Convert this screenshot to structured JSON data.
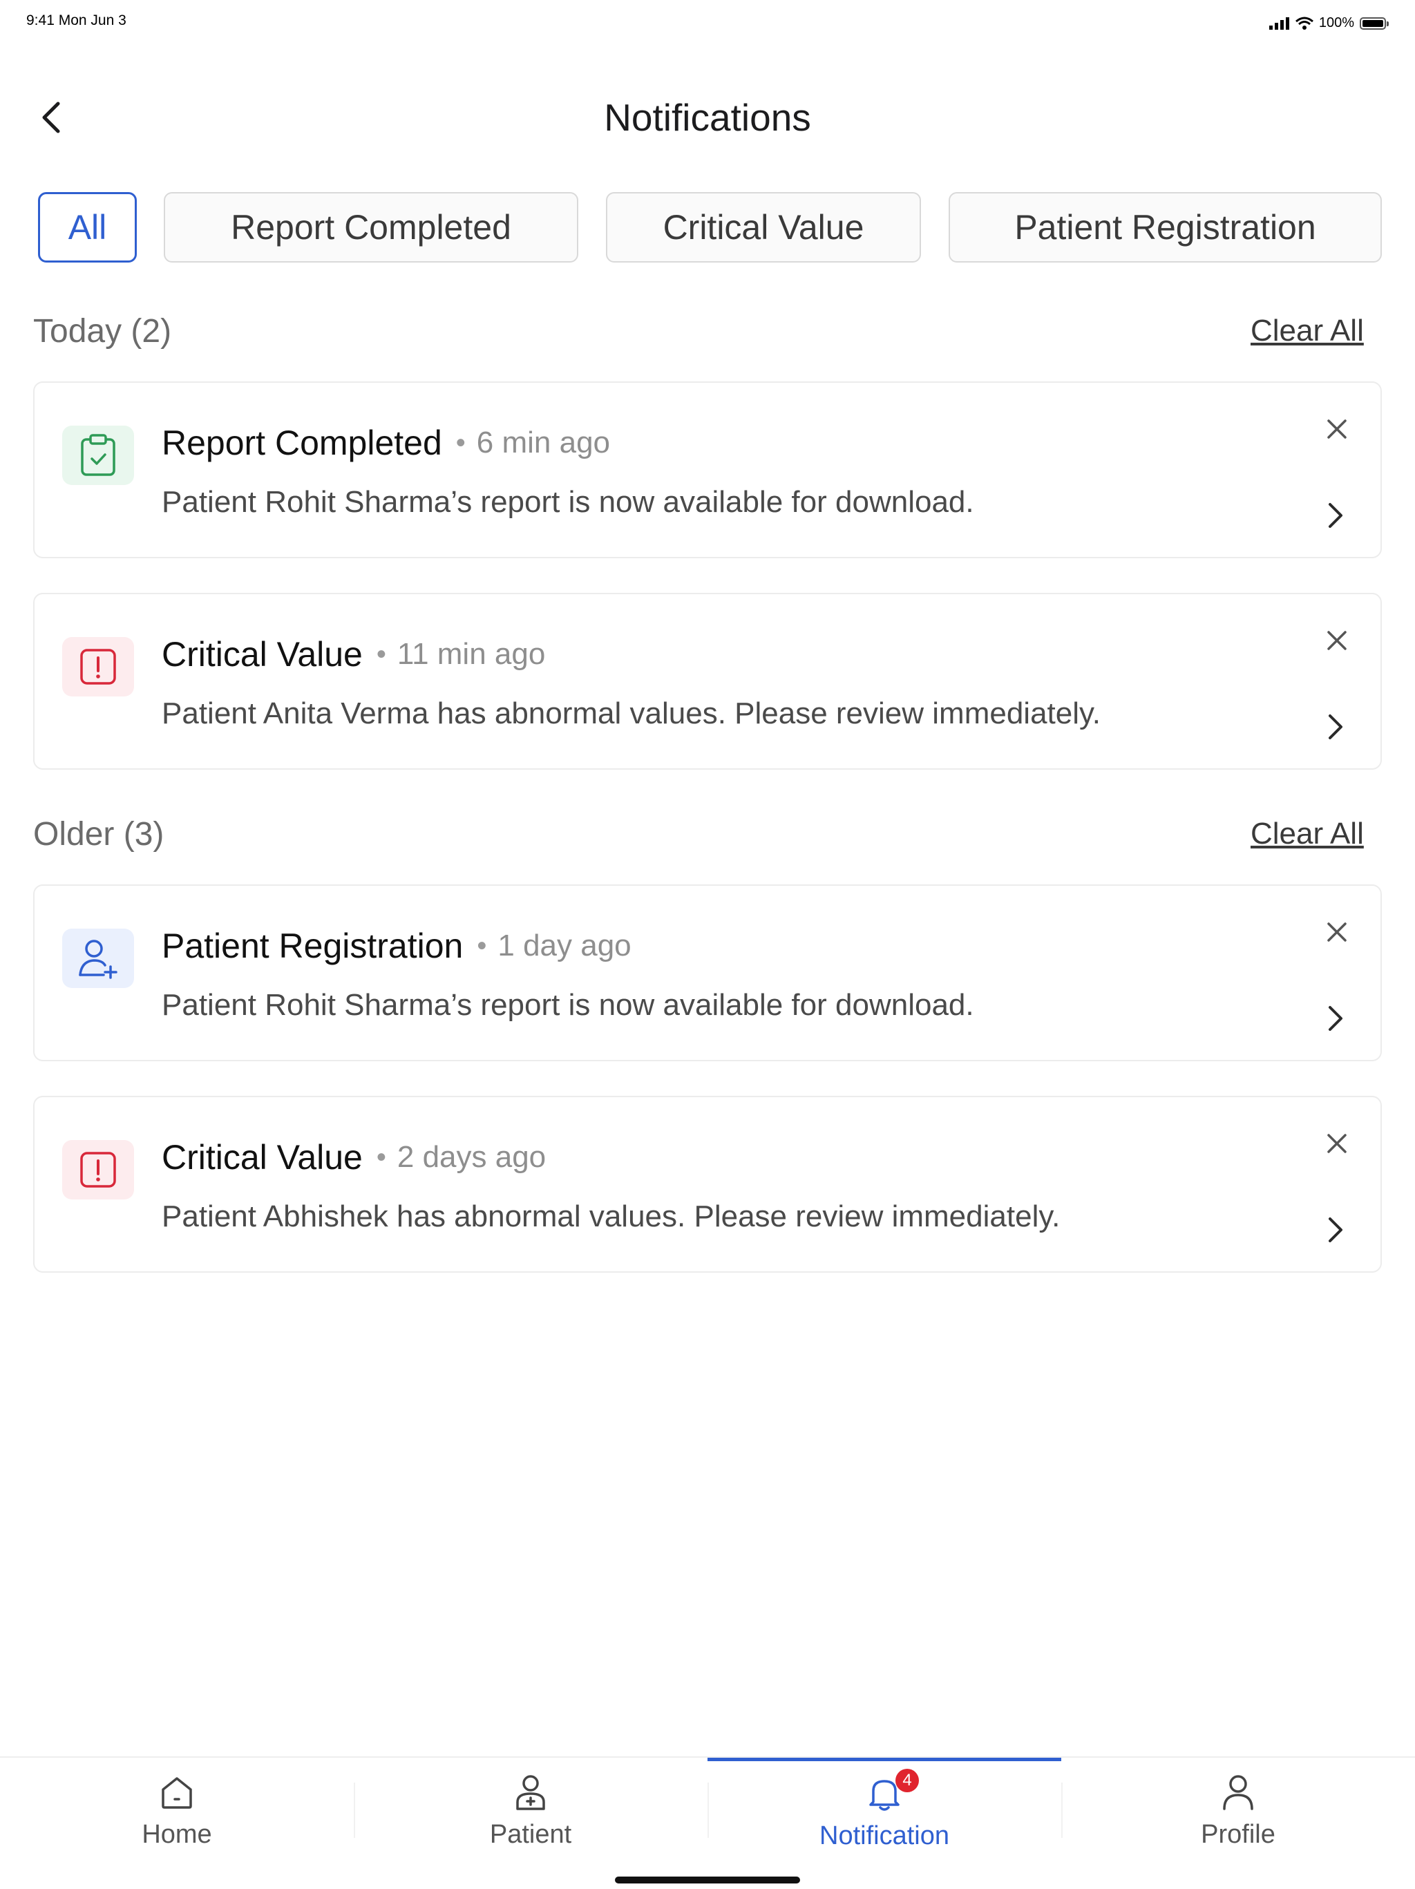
{
  "status_bar": {
    "time": "9:41  Mon Jun 3",
    "battery": "100%"
  },
  "header": {
    "title": "Notifications"
  },
  "filters": [
    {
      "label": "All",
      "active": true
    },
    {
      "label": "Report Completed",
      "active": false
    },
    {
      "label": "Critical Value",
      "active": false
    },
    {
      "label": "Patient Registration",
      "active": false
    }
  ],
  "sections": [
    {
      "title": "Today (2)",
      "clear_label": "Clear All",
      "items": [
        {
          "type": "report",
          "title": "Report Completed",
          "time": "6 min ago",
          "message": "Patient Rohit Sharma’s report is now available for download."
        },
        {
          "type": "critical",
          "title": "Critical Value",
          "time": "11 min ago",
          "message": "Patient Anita Verma has abnormal values. Please review immediately."
        }
      ]
    },
    {
      "title": "Older (3)",
      "clear_label": "Clear All",
      "items": [
        {
          "type": "registration",
          "title": "Patient Registration",
          "time": "1 day ago",
          "message": "Patient Rohit Sharma’s report is now available for download."
        },
        {
          "type": "critical",
          "title": "Critical Value",
          "time": "2 days ago",
          "message": "Patient Abhishek has abnormal values. Please review immediately."
        }
      ]
    }
  ],
  "tab_bar": {
    "tabs": [
      {
        "label": "Home",
        "icon": "home-icon"
      },
      {
        "label": "Patient",
        "icon": "patient-icon"
      },
      {
        "label": "Notification",
        "icon": "bell-icon",
        "active": true,
        "badge": "4"
      },
      {
        "label": "Profile",
        "icon": "profile-icon"
      }
    ]
  },
  "colors": {
    "accent": "#2f5fd0",
    "critical": "#d8283a",
    "success": "#2e9b56",
    "badge": "#e0242e"
  }
}
